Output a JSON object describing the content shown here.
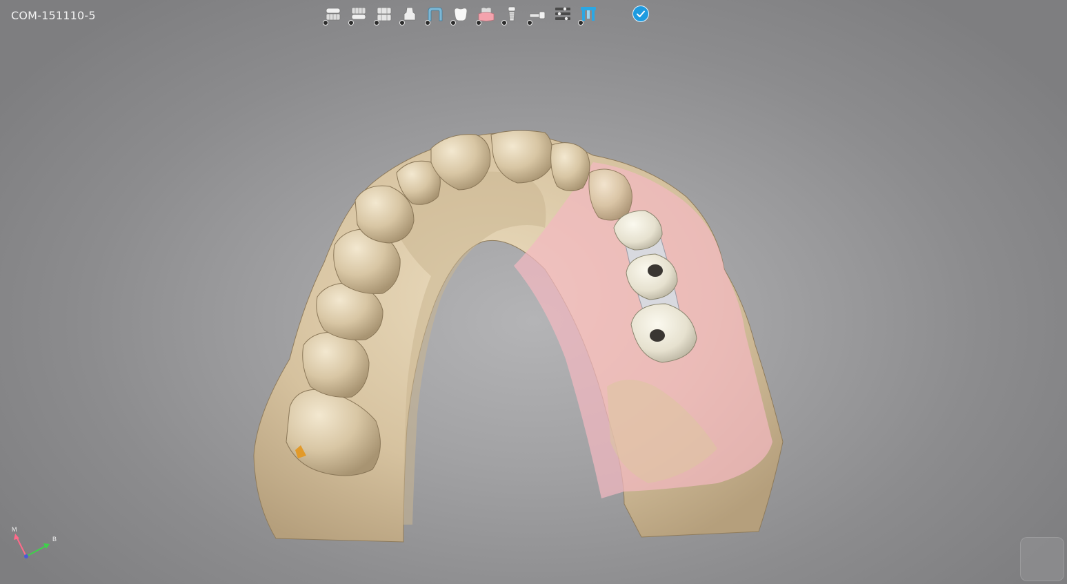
{
  "case": {
    "id": "COM-151110-5"
  },
  "toolbar": {
    "tools": [
      {
        "name": "upper-jaw-scan-icon",
        "tint": "#e9e9e9"
      },
      {
        "name": "lower-jaw-scan-icon",
        "tint": "#e9e9e9"
      },
      {
        "name": "bite-scan-icon",
        "tint": "#e9e9e9"
      },
      {
        "name": "abutment-icon",
        "tint": "#e9e9e9"
      },
      {
        "name": "bar-framework-icon",
        "tint": "#7db8d6"
      },
      {
        "name": "crown-icon",
        "tint": "#f5f5f5"
      },
      {
        "name": "gingiva-icon",
        "tint": "#f4a3ad"
      },
      {
        "name": "implant-icon",
        "tint": "#e9e9e9"
      },
      {
        "name": "screw-icon",
        "tint": "#e9e9e9"
      },
      {
        "name": "settings-sliders-icon",
        "tint": "#e9e9e9"
      },
      {
        "name": "scan-body-icon",
        "tint": "#2ba7e3"
      }
    ],
    "confirm_color": "#1e9be0"
  },
  "axis": {
    "m_label": "M",
    "b_label": "B"
  },
  "colors": {
    "stone": "#d9c7a6",
    "gingiva_overlay": "#f2b9c0",
    "bar": "#e8e4d6",
    "background": "#a2a2a4"
  }
}
